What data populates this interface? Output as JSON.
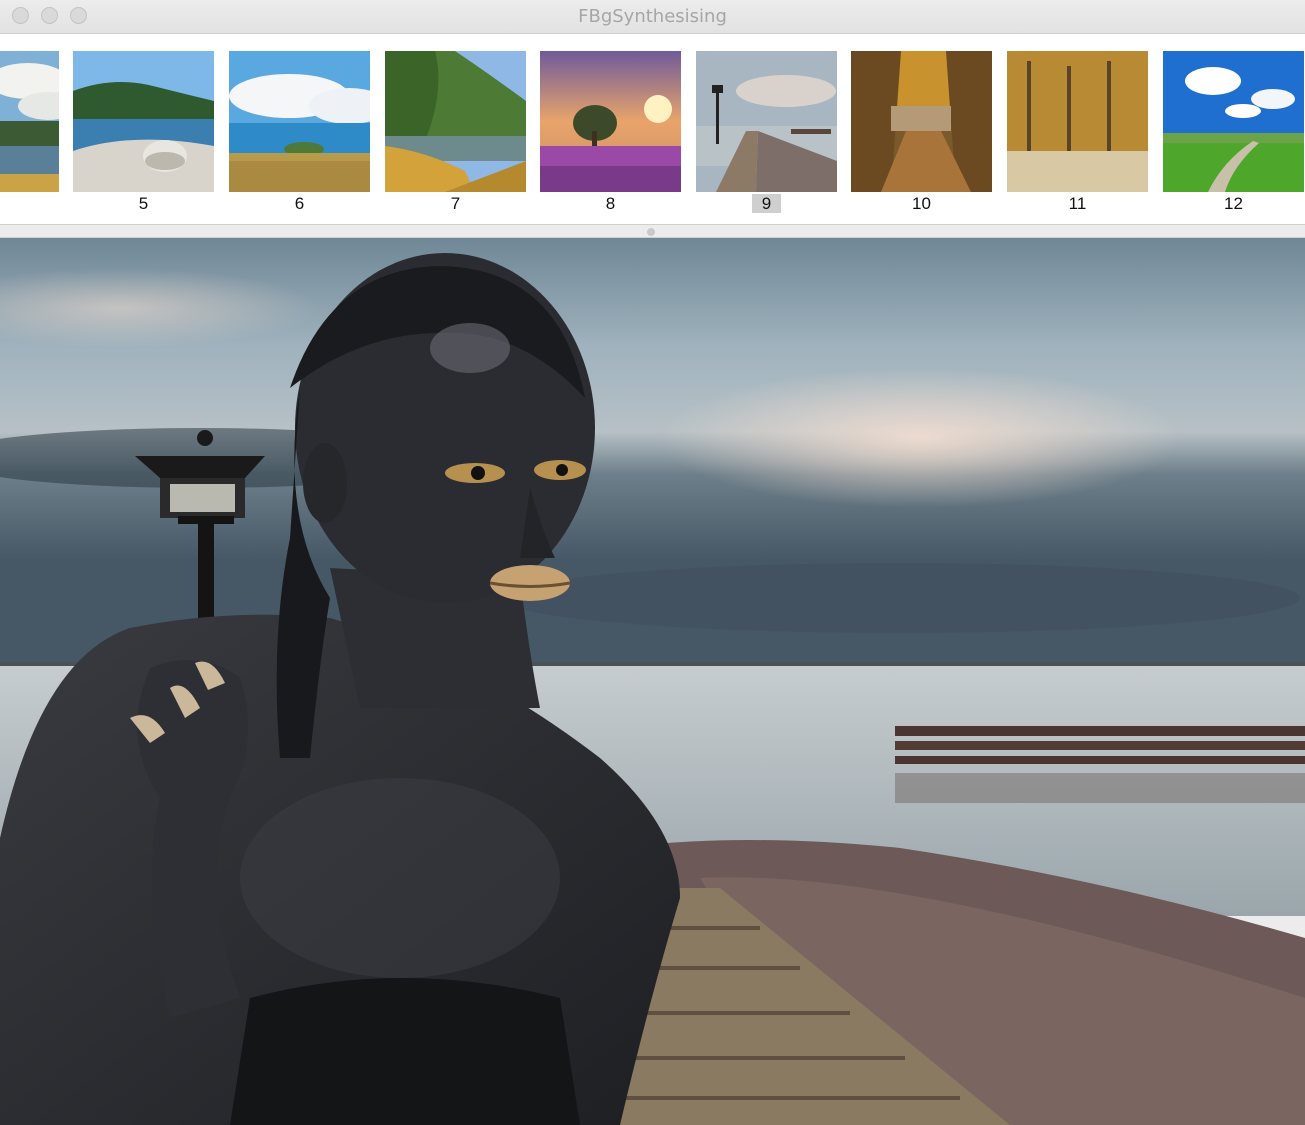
{
  "window": {
    "title": "FBgSynthesising"
  },
  "traffic_lights": [
    "close-button",
    "minimize-button",
    "zoom-button"
  ],
  "thumbnails": [
    {
      "label": "",
      "scene": "lake-landscape"
    },
    {
      "label": "5",
      "scene": "lakeside-boulder"
    },
    {
      "label": "6",
      "scene": "sea-meadow"
    },
    {
      "label": "7",
      "scene": "autumn-pond"
    },
    {
      "label": "8",
      "scene": "heather-sunset"
    },
    {
      "label": "9",
      "scene": "pier-lamp"
    },
    {
      "label": "10",
      "scene": "autumn-alley"
    },
    {
      "label": "11",
      "scene": "autumn-forest"
    },
    {
      "label": "12",
      "scene": "green-path"
    }
  ],
  "selected_thumbnail": "9",
  "composite": {
    "background": "pier-lamp",
    "foreground": "portrait-figure"
  },
  "colors": {
    "selection": "#cfcfcf",
    "sky": "#9fb2bd",
    "water": "#aab4b8"
  }
}
